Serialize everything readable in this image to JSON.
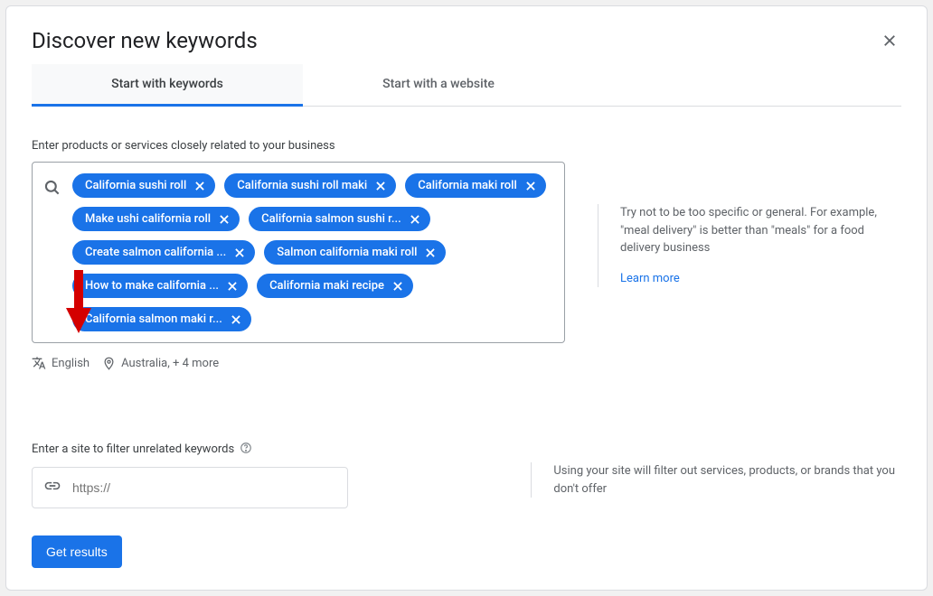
{
  "header": {
    "title": "Discover new keywords"
  },
  "tabs": {
    "keywords": "Start with keywords",
    "website": "Start with a website"
  },
  "keywordSection": {
    "label": "Enter products or services closely related to your business",
    "chips": [
      "California sushi roll",
      "California sushi roll maki",
      "California maki roll",
      "Make ushi california roll",
      "California salmon sushi r...",
      "Create salmon california ...",
      "Salmon california maki roll",
      "How to make california ...",
      "California maki recipe",
      "California salmon maki r..."
    ]
  },
  "locale": {
    "language": "English",
    "location": "Australia, + 4 more"
  },
  "hint": {
    "text": "Try not to be too specific or general. For example, \"meal delivery\" is better than \"meals\" for a food delivery business",
    "learnMore": "Learn more"
  },
  "siteSection": {
    "label": "Enter a site to filter unrelated keywords",
    "placeholder": "https://",
    "hint": "Using your site will filter out services, products, or brands that you don't offer"
  },
  "actions": {
    "getResults": "Get results"
  }
}
